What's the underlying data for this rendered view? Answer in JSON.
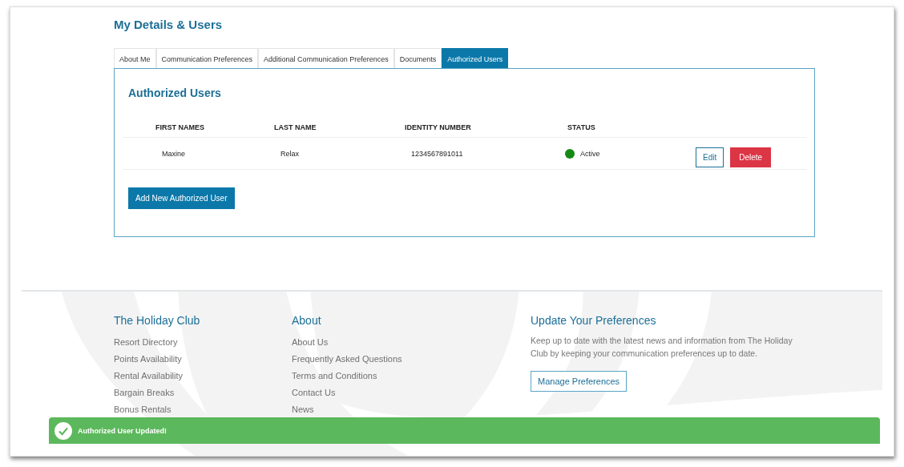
{
  "page": {
    "title": "My Details & Users"
  },
  "tabs": [
    {
      "label": "About Me",
      "selected": false
    },
    {
      "label": "Communication Preferences",
      "selected": false
    },
    {
      "label": "Additional Communication Preferences",
      "selected": false
    },
    {
      "label": "Documents",
      "selected": false
    },
    {
      "label": "Authorized Users",
      "selected": true
    }
  ],
  "panel": {
    "title": "Authorized Users",
    "table": {
      "columns": [
        "FIRST NAMES",
        "LAST NAME",
        "IDENTITY NUMBER",
        "STATUS"
      ],
      "rows": [
        {
          "first_name": "Maxine",
          "last_name": "Relax",
          "identity_number": "1234567891011",
          "status": "Active",
          "color": "#138a13",
          "actions": [
            "Edit",
            "Delete"
          ]
        }
      ]
    },
    "add_button": "Add New Authorized User"
  },
  "footer": {
    "columns": [
      {
        "title": "The Holiday Club",
        "links": [
          "Resort Directory",
          "Points Availability",
          "Rental Availability",
          "Bargain Breaks",
          "Bonus Rentals"
        ]
      },
      {
        "title": "About",
        "links": [
          "About Us",
          "Frequently Asked Questions",
          "Terms and Conditions",
          "Contact Us",
          "News"
        ]
      }
    ],
    "preferences": {
      "title": "Update Your Preferences",
      "text": "Keep up to date with the latest news and information from The Holiday Club by keeping your communication preferences up to date.",
      "button": "Manage Preferences"
    }
  },
  "toast": {
    "message": "Authorized User Updated!"
  }
}
